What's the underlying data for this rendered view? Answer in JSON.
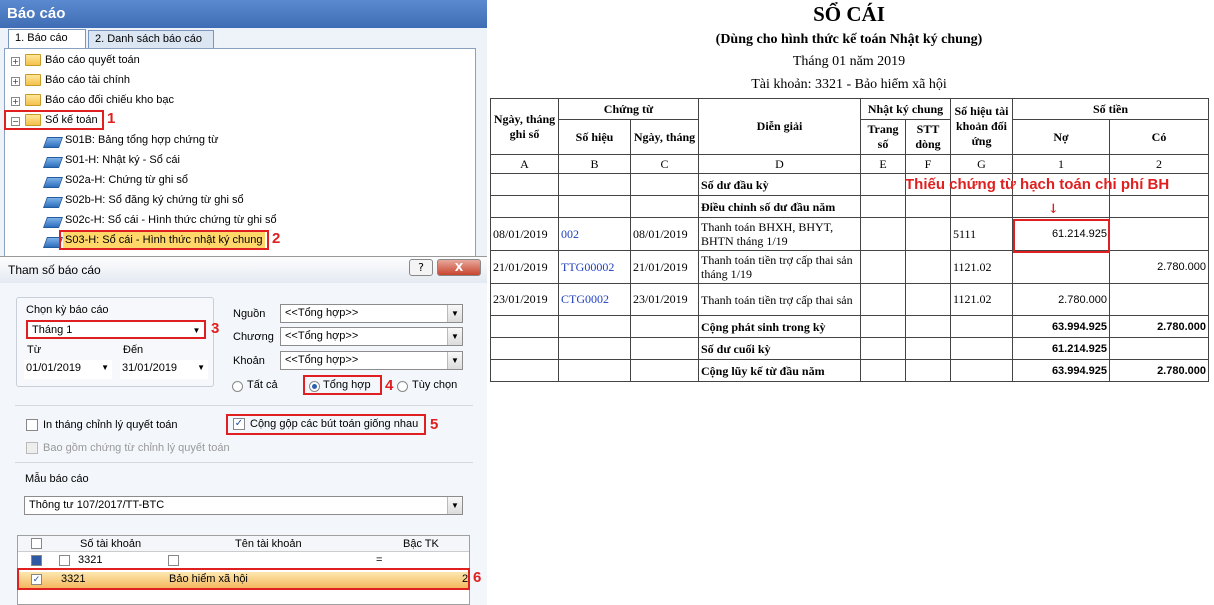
{
  "left_panel": {
    "title": "Báo cáo",
    "tabs": [
      "1. Báo cáo",
      "2. Danh sách báo cáo"
    ],
    "tree": [
      "Báo cáo quyết toán",
      "Báo cáo tài chính",
      "Báo cáo đối chiếu kho bạc",
      "Sổ kế toán"
    ],
    "tree_children": [
      "S01B: Bảng tổng hợp chứng từ",
      "S01-H: Nhật ký - Sổ cái",
      "S02a-H: Chứng từ ghi sổ",
      "S02b-H: Sổ đăng ký chứng từ ghi sổ",
      "S02c-H: Sổ cái - Hình thức chứng từ ghi sổ",
      "S03-H: Sổ cái - Hình thức nhật ký chung"
    ],
    "dialog": {
      "title": "Tham số báo cáo",
      "help": "?",
      "close": "X",
      "period_label": "Chọn kỳ báo cáo",
      "period_value": "Tháng 1",
      "from_label": "Từ",
      "to_label": "Đến",
      "from_value": "01/01/2019",
      "to_value": "31/01/2019",
      "nguon_label": "Nguồn",
      "nguon_value": "<<Tổng hợp>>",
      "chuong_label": "Chương",
      "chuong_value": "<<Tổng hợp>>",
      "khoan_label": "Khoản",
      "khoan_value": "<<Tổng hợp>>",
      "radio_all": "Tất cả",
      "radio_sum": "Tổng hợp",
      "radio_custom": "Tùy chọn",
      "chk_month": "In tháng chỉnh lý quyết toán",
      "chk_merge": "Cộng gộp các bút toán giống nhau",
      "chk_include": "Bao gồm chứng từ chỉnh lý quyết toán",
      "template_label": "Mẫu báo cáo",
      "template_value": "Thông tư 107/2017/TT-BTC",
      "grid_headers": [
        "Số tài khoản",
        "Tên tài khoản",
        "Bậc TK"
      ],
      "grid_filter": "3321",
      "grid_filter_op": "=",
      "grid_row": {
        "account": "3321",
        "name": "Bảo hiểm xã hội",
        "level": "2"
      }
    },
    "markers": [
      "1",
      "2",
      "3",
      "4",
      "5",
      "6"
    ]
  },
  "report": {
    "title": "SỔ CÁI",
    "subtitle": "(Dùng cho hình thức kế toán Nhật ký chung)",
    "period": "Tháng 01 năm 2019",
    "account": "Tài khoản: 3321 - Bảo hiểm xã hội",
    "annotation": "Thiếu chứng từ hạch toán chi phí BH",
    "headers": {
      "date": "Ngày, tháng ghi sổ",
      "voucher": "Chứng từ",
      "voucher_no": "Số hiệu",
      "voucher_date": "Ngày, tháng",
      "desc": "Diễn giải",
      "journal": "Nhật ký chung",
      "page": "Trang số",
      "line": "STT dòng",
      "contra": "Số hiệu tài khoản đối ứng",
      "amount": "Số tiền",
      "debit": "Nợ",
      "credit": "Có"
    },
    "col_letters": [
      "A",
      "B",
      "C",
      "D",
      "E",
      "F",
      "G",
      "1",
      "2"
    ],
    "rows": [
      {
        "date": "",
        "no": "",
        "vdate": "",
        "desc": "Số dư đầu kỳ",
        "contra": "",
        "debit": "",
        "credit": "",
        "bold": true
      },
      {
        "date": "",
        "no": "",
        "vdate": "",
        "desc": "Điều chỉnh số dư đầu năm",
        "contra": "",
        "debit": "",
        "credit": "",
        "bold": true
      },
      {
        "date": "08/01/2019",
        "no": "002",
        "vdate": "08/01/2019",
        "desc": "Thanh toán BHXH, BHYT, BHTN tháng 1/19",
        "contra": "5111",
        "debit": "61.214.925",
        "credit": "",
        "bold": false
      },
      {
        "date": "21/01/2019",
        "no": "TTG00002",
        "vdate": "21/01/2019",
        "desc": "Thanh toán tiền trợ cấp thai sản tháng 1/19",
        "contra": "1121.02",
        "debit": "",
        "credit": "2.780.000",
        "bold": false
      },
      {
        "date": "23/01/2019",
        "no": "CTG0002",
        "vdate": "23/01/2019",
        "desc": "Thanh toán tiền trợ cấp thai sản",
        "contra": "1121.02",
        "debit": "2.780.000",
        "credit": "",
        "bold": false
      },
      {
        "date": "",
        "no": "",
        "vdate": "",
        "desc": "Cộng phát sinh trong kỳ",
        "contra": "",
        "debit": "63.994.925",
        "credit": "2.780.000",
        "bold": true
      },
      {
        "date": "",
        "no": "",
        "vdate": "",
        "desc": "Số dư cuối kỳ",
        "contra": "",
        "debit": "61.214.925",
        "credit": "",
        "bold": true
      },
      {
        "date": "",
        "no": "",
        "vdate": "",
        "desc": "Cộng lũy kế từ đầu năm",
        "contra": "",
        "debit": "63.994.925",
        "credit": "2.780.000",
        "bold": true
      }
    ]
  },
  "colors": {
    "accent": "#3f6db5",
    "marker": "#e02020",
    "link": "#1f3fbf"
  }
}
